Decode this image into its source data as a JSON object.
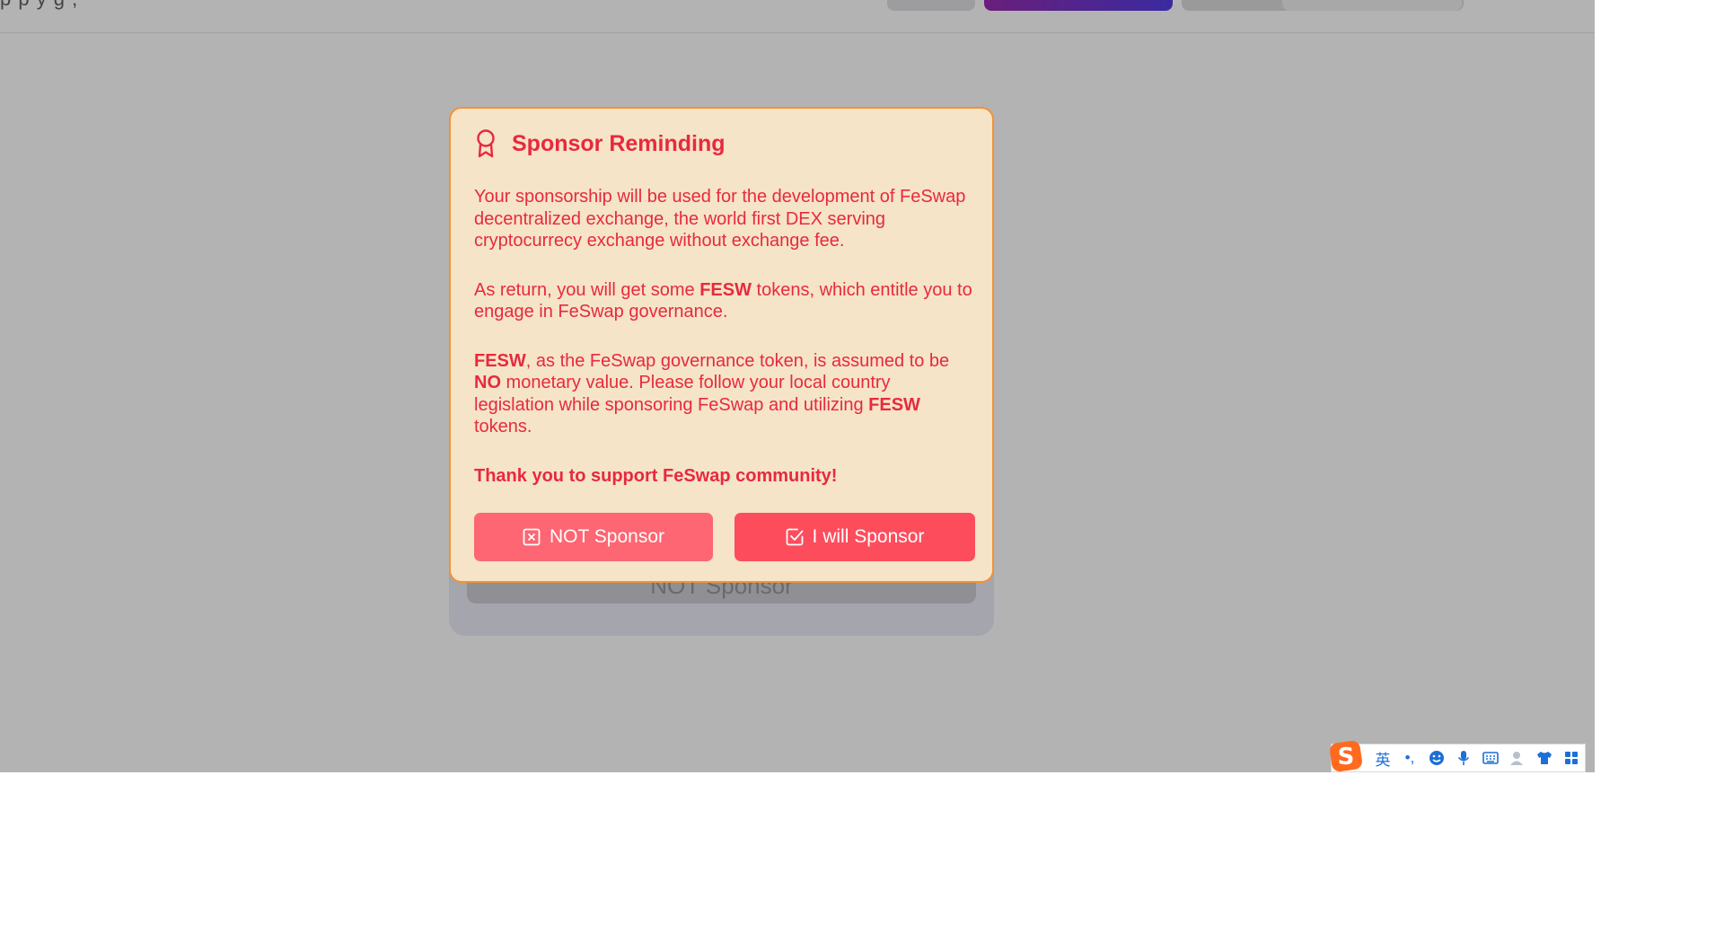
{
  "top_bar": {
    "fragment_text": "p    p    y        g                  ,"
  },
  "background_card": {
    "button_label": "NOT Sponsor"
  },
  "modal": {
    "title": "Sponsor Reminding",
    "icon": "award-ribbon-icon",
    "paragraph1": "Your sponsorship will be used for the development of FeSwap decentralized exchange, the world first DEX serving cryptocurrecy exchange without exchange fee.",
    "paragraph2": {
      "pre": "As return, you will get some ",
      "token": "FESW",
      "post": " tokens, which entitle you to engage in FeSwap governance."
    },
    "paragraph3": {
      "token_a": "FESW",
      "part1": ", as the FeSwap governance token, is assumed to be ",
      "no": "NO",
      "part2": " monetary value. Please follow your local country legislation while sponsoring FeSwap and utilizing ",
      "token_b": "FESW",
      "part3": " tokens."
    },
    "thanks": "Thank you to support FeSwap community!",
    "buttons": {
      "not_sponsor": "NOT Sponsor",
      "will_sponsor": "I will Sponsor"
    },
    "colors": {
      "background": "#f5e4c7",
      "border": "#f39234",
      "text": "#e8293f",
      "not_button": "#fd6672",
      "will_button": "#fd4d5d"
    }
  },
  "ime_toolbar": {
    "logo": "sogou-s-logo",
    "mode_label": "英",
    "punct_label": "•,",
    "icons": [
      "emoji-icon",
      "microphone-icon",
      "keyboard-icon",
      "user-icon",
      "shirt-icon",
      "apps-grid-icon"
    ]
  }
}
